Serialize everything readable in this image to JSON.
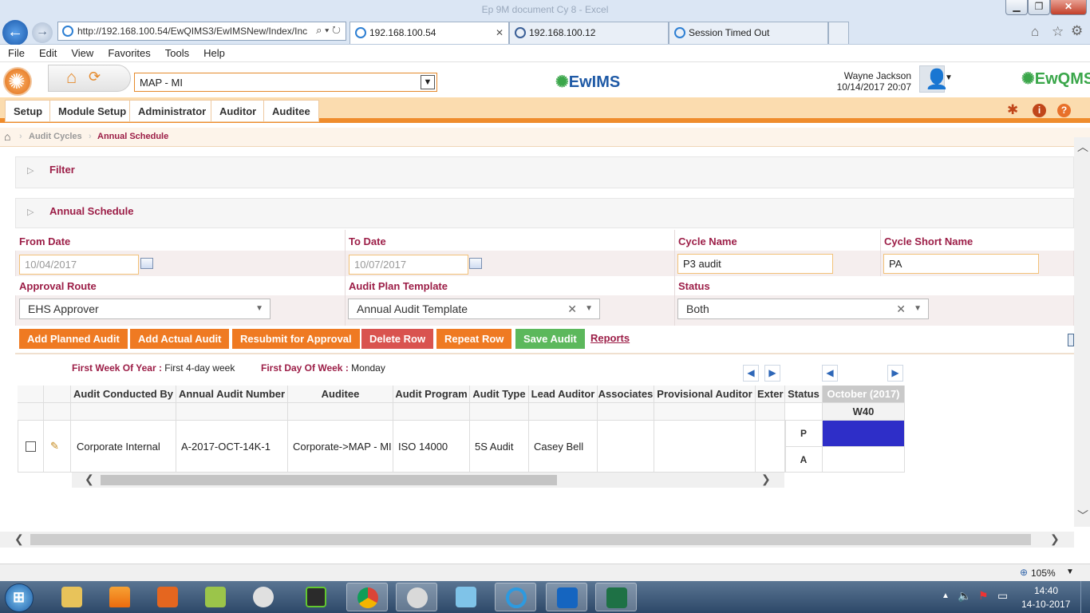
{
  "window": {
    "title": "Ep 9M document Cy 8 - Excel"
  },
  "browser": {
    "url": "http://192.168.100.54/EwQIMS3/EwIMSNew/Index/Inc",
    "tabs": [
      {
        "label": "192.168.100.54"
      },
      {
        "label": "192.168.100.12"
      },
      {
        "label": "Session Timed Out"
      }
    ],
    "menu": [
      "File",
      "Edit",
      "View",
      "Favorites",
      "Tools",
      "Help"
    ],
    "zoom": "105%"
  },
  "header": {
    "site": "MAP - MI",
    "logo_center": "EwIMS",
    "logo_right": "EwQMS",
    "user_name": "Wayne Jackson",
    "user_datetime": "10/14/2017 20:07"
  },
  "nav": {
    "tabs": [
      "Setup",
      "Module Setup",
      "Administrator",
      "Auditor",
      "Auditee"
    ]
  },
  "breadcrumb": {
    "parent": "Audit Cycles",
    "current": "Annual Schedule"
  },
  "panels": {
    "filter": "Filter",
    "annual": "Annual Schedule"
  },
  "form": {
    "from_date_label": "From Date",
    "from_date": "10/04/2017",
    "to_date_label": "To Date",
    "to_date": "10/07/2017",
    "cycle_name_label": "Cycle Name",
    "cycle_name": "P3 audit",
    "cycle_short_label": "Cycle Short Name",
    "cycle_short": "PA",
    "approval_label": "Approval Route",
    "approval": "EHS Approver",
    "template_label": "Audit Plan Template",
    "template": "Annual Audit Template",
    "status_label": "Status",
    "status": "Both"
  },
  "buttons": {
    "add_planned": "Add Planned Audit",
    "add_actual": "Add Actual Audit",
    "resubmit": "Resubmit for Approval",
    "delete": "Delete Row",
    "repeat": "Repeat Row",
    "save": "Save Audit",
    "reports": "Reports"
  },
  "week_info": {
    "first_week_label": "First Week Of Year :",
    "first_week": "First 4-day week",
    "first_day_label": "First Day Of Week :",
    "first_day": "Monday"
  },
  "grid": {
    "columns": [
      "Audit Conducted By",
      "Annual Audit Number",
      "Auditee",
      "Audit Program",
      "Audit Type",
      "Lead Auditor",
      "Associates",
      "Provisional Auditor",
      "Exter",
      "Status"
    ],
    "month": "October (2017)",
    "week": "W40",
    "rows": [
      {
        "conducted_by": "Corporate Internal",
        "number": "A-2017-OCT-14K-1",
        "auditee": "Corporate->MAP - MI",
        "program": "ISO 14000",
        "type": "5S Audit",
        "lead": "Casey Bell",
        "associates": "",
        "provisional": "",
        "exter": "",
        "status_p": "P",
        "status_a": "A"
      }
    ],
    "planned_color": "#2e2ec8"
  },
  "taskbar": {
    "time": "14:40",
    "date": "14-10-2017"
  }
}
